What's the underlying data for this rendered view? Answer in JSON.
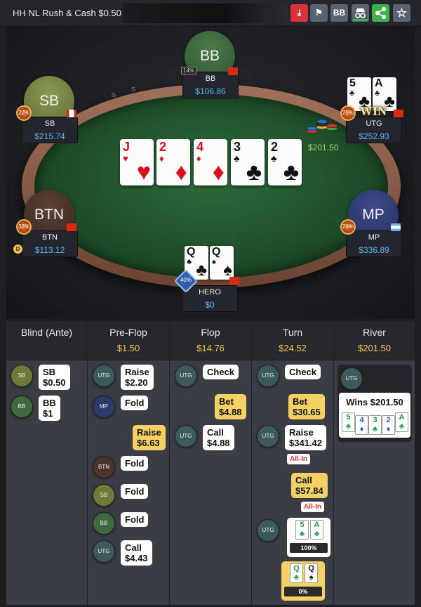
{
  "header": {
    "title": "HH NL Rush & Cash $0.50 / $1 - ",
    "buttons": [
      {
        "name": "download",
        "label": "⤓",
        "color": "#d6333a"
      },
      {
        "name": "flag",
        "label": "⚑",
        "color": "#5b6370"
      },
      {
        "name": "bb",
        "label": "BB",
        "color": "#5b6370"
      },
      {
        "name": "incognito",
        "label": "🕶",
        "color": "#5b6370"
      },
      {
        "name": "share",
        "label": "⋲",
        "color": "#3db24a"
      },
      {
        "name": "star",
        "label": "☆",
        "color": "#5b6370"
      }
    ]
  },
  "table": {
    "rail_text": [
      "S",
      "S",
      "A",
      "U",
      "S",
      "A",
      "S"
    ],
    "pot": "$201.50",
    "board": [
      {
        "rank": "J",
        "suit": "♥",
        "color": "red"
      },
      {
        "rank": "2",
        "suit": "♦",
        "color": "red"
      },
      {
        "rank": "4",
        "suit": "♦",
        "color": "red"
      },
      {
        "rank": "3",
        "suit": "♣",
        "color": "blk"
      },
      {
        "rank": "2",
        "suit": "♣",
        "color": "blk"
      }
    ],
    "seats": {
      "bb": {
        "avatar": "BB",
        "name": "BB",
        "stack": "$106.86",
        "pct": "14%"
      },
      "sb": {
        "avatar": "SB",
        "name": "SB",
        "stack": "$215.74",
        "pct": "22%"
      },
      "utg": {
        "name": "UTG",
        "stack": "$252.93",
        "pct": "20%",
        "badge": "WIN",
        "cards": [
          {
            "rank": "5",
            "suit": "♣"
          },
          {
            "rank": "A",
            "suit": "♣"
          }
        ]
      },
      "btn": {
        "avatar": "BTN",
        "name": "BTN",
        "stack": "$113.12",
        "pct": "32%",
        "dealer": "D"
      },
      "mp": {
        "avatar": "MP",
        "name": "MP",
        "stack": "$336.89",
        "pct": "26%"
      },
      "hero": {
        "name": "HERO",
        "stack": "$0",
        "pct": "40%",
        "cards": [
          {
            "rank": "Q",
            "suit": "♣"
          },
          {
            "rank": "Q",
            "suit": "♠"
          }
        ]
      }
    }
  },
  "streets": [
    {
      "name": "Blind (Ante)",
      "pot": ""
    },
    {
      "name": "Pre-Flop",
      "pot": "$1.50"
    },
    {
      "name": "Flop",
      "pot": "$14.76"
    },
    {
      "name": "Turn",
      "pot": "$24.52"
    },
    {
      "name": "River",
      "pot": "$201.50"
    }
  ],
  "actions": {
    "blind": [
      {
        "pos": "SB",
        "line1": "SB",
        "line2": "$0.50"
      },
      {
        "pos": "BB",
        "line1": "BB",
        "line2": "$1"
      }
    ],
    "preflop": [
      {
        "pos": "UTG",
        "line1": "Raise",
        "line2": "$2.20"
      },
      {
        "pos": "MP",
        "line1": "Fold",
        "line2": ""
      },
      {
        "pos": "",
        "line1": "Raise",
        "line2": "$6.63"
      },
      {
        "pos": "BTN",
        "line1": "Fold",
        "line2": ""
      },
      {
        "pos": "SB",
        "line1": "Fold",
        "line2": ""
      },
      {
        "pos": "BB",
        "line1": "Fold",
        "line2": ""
      },
      {
        "pos": "UTG",
        "line1": "Call",
        "line2": "$4.43"
      }
    ],
    "flop": [
      {
        "pos": "UTG",
        "line1": "Check",
        "line2": ""
      },
      {
        "pos": "",
        "line1": "Bet",
        "line2": "$4.88"
      },
      {
        "pos": "UTG",
        "line1": "Call",
        "line2": "$4.88"
      }
    ],
    "turn": [
      {
        "pos": "UTG",
        "line1": "Check",
        "line2": ""
      },
      {
        "pos": "",
        "line1": "Bet",
        "line2": "$30.65"
      },
      {
        "pos": "UTG",
        "line1": "Raise",
        "line2": "$341.42",
        "tag": "All-In"
      },
      {
        "pos": "",
        "line1": "Call",
        "line2": "$57.84",
        "tag": "All-In"
      },
      {
        "pos": "UTG",
        "equity": "100%"
      },
      {
        "pos": "",
        "equity": "0%"
      }
    ],
    "river": {
      "pos": "UTG",
      "text": "Wins $201.50",
      "cards": [
        {
          "rank": "5",
          "suit": "♣",
          "color": "#1e9e3e"
        },
        {
          "rank": "4",
          "suit": "♦",
          "color": "#2b5fd1"
        },
        {
          "rank": "3",
          "suit": "♣",
          "color": "#1e9e3e"
        },
        {
          "rank": "2",
          "suit": "♦",
          "color": "#2b5fd1"
        },
        {
          "rank": "A",
          "suit": "♣",
          "color": "#1e9e3e"
        }
      ]
    }
  }
}
